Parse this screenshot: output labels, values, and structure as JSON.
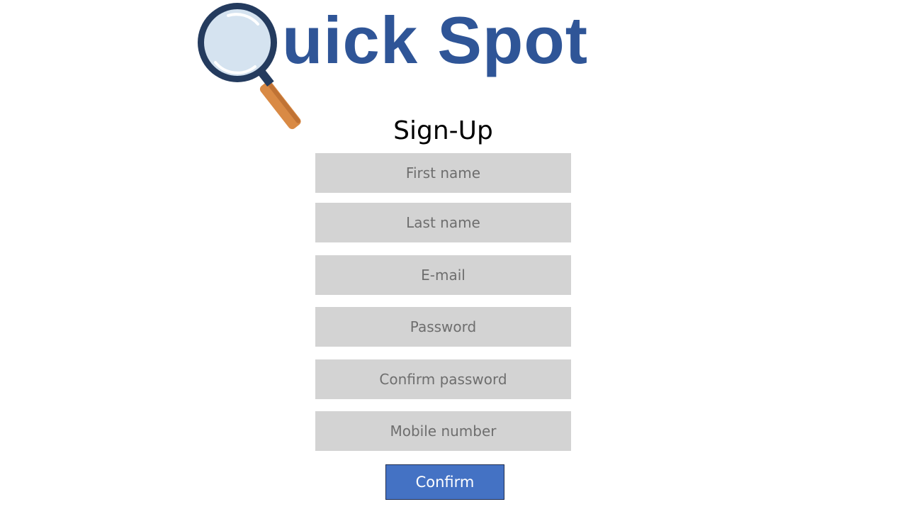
{
  "brand": {
    "logo_text": "uick Spot",
    "logo_icon": "magnifying-glass-icon",
    "colors": {
      "brand_blue": "#2f5597",
      "lens_rim": "#243b5e",
      "lens_fill": "#d5e3f0",
      "handle": "#d98a45"
    }
  },
  "form": {
    "title": "Sign-Up",
    "fields": [
      {
        "placeholder": "First name",
        "value": ""
      },
      {
        "placeholder": "Last name",
        "value": ""
      },
      {
        "placeholder": "E-mail",
        "value": ""
      },
      {
        "placeholder": "Password",
        "value": ""
      },
      {
        "placeholder": "Confirm password",
        "value": ""
      },
      {
        "placeholder": "Mobile number",
        "value": ""
      }
    ],
    "confirm_label": "Confirm",
    "colors": {
      "field_bg": "#d3d3d3",
      "button_bg": "#4472c4"
    }
  }
}
